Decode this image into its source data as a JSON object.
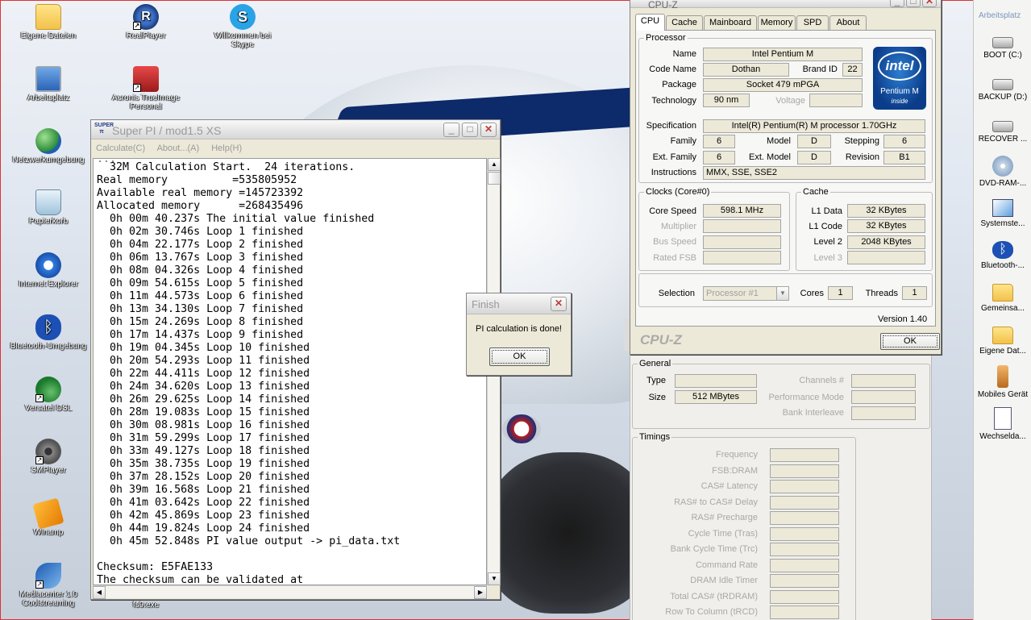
{
  "desktop": {
    "icons": [
      {
        "label": "Eigene Dateien",
        "icon": "folder-icon"
      },
      {
        "label": "Arbeitsplatz",
        "icon": "computer-icon"
      },
      {
        "label": "Netzwerkumgebung",
        "icon": "network-icon"
      },
      {
        "label": "Papierkorb",
        "icon": "recycle-bin-icon"
      },
      {
        "label": "Internet Explorer",
        "icon": "internet-explorer-icon"
      },
      {
        "label": "Bluetooth-Umgebung",
        "icon": "bluetooth-icon"
      },
      {
        "label": "Versatel DSL",
        "icon": "dsl-icon"
      },
      {
        "label": "SMPlayer",
        "icon": "smplayer-icon"
      },
      {
        "label": "Winamp",
        "icon": "winamp-icon"
      },
      {
        "label": "Mediacenter 1.0 Coolstreaming",
        "icon": "mediacenter-icon"
      },
      {
        "label": "RealPlayer",
        "icon": "realplayer-icon"
      },
      {
        "label": "Acronis TrueImage Personal",
        "icon": "acronis-icon"
      },
      {
        "label": "fs9.exe",
        "icon": "exe-icon"
      },
      {
        "label": "Willkommen bei Skype",
        "icon": "skype-icon"
      }
    ]
  },
  "rightbar": {
    "title": "Arbeitsplatz",
    "items": [
      {
        "label": "BOOT (C:)",
        "icon": "hard-drive-icon"
      },
      {
        "label": "BACKUP (D:)",
        "icon": "hard-drive-icon"
      },
      {
        "label": "RECOVER ...",
        "icon": "hard-drive-icon"
      },
      {
        "label": "DVD-RAM-...",
        "icon": "dvd-drive-icon"
      },
      {
        "label": "Systemste...",
        "icon": "control-panel-icon"
      },
      {
        "label": "Bluetooth-...",
        "icon": "bluetooth-icon"
      },
      {
        "label": "Gemeinsa...",
        "icon": "folder-icon"
      },
      {
        "label": "Eigene Dat...",
        "icon": "folder-icon"
      },
      {
        "label": "Mobiles Gerät",
        "icon": "mobile-device-icon"
      },
      {
        "label": "Wechselda...",
        "icon": "removable-drive-icon"
      }
    ]
  },
  "superpi": {
    "title": "Super PI / mod1.5 XS",
    "icon_text": "SUPER π",
    "menu": [
      "Calculate(C)",
      "About...(A)",
      "Help(H)"
    ],
    "cut_line": "...",
    "lines": [
      "  32M Calculation Start.  24 iterations.",
      "Real memory          =535805952",
      "Available real memory =145723392",
      "Allocated memory      =268435496",
      "  0h 00m 40.237s The initial value finished",
      "  0h 02m 30.746s Loop 1 finished",
      "  0h 04m 22.177s Loop 2 finished",
      "  0h 06m 13.767s Loop 3 finished",
      "  0h 08m 04.326s Loop 4 finished",
      "  0h 09m 54.615s Loop 5 finished",
      "  0h 11m 44.573s Loop 6 finished",
      "  0h 13m 34.130s Loop 7 finished",
      "  0h 15m 24.269s Loop 8 finished",
      "  0h 17m 14.437s Loop 9 finished",
      "  0h 19m 04.345s Loop 10 finished",
      "  0h 20m 54.293s Loop 11 finished",
      "  0h 22m 44.411s Loop 12 finished",
      "  0h 24m 34.620s Loop 13 finished",
      "  0h 26m 29.625s Loop 14 finished",
      "  0h 28m 19.083s Loop 15 finished",
      "  0h 30m 08.981s Loop 16 finished",
      "  0h 31m 59.299s Loop 17 finished",
      "  0h 33m 49.127s Loop 18 finished",
      "  0h 35m 38.735s Loop 19 finished",
      "  0h 37m 28.152s Loop 20 finished",
      "  0h 39m 16.568s Loop 21 finished",
      "  0h 41m 03.642s Loop 22 finished",
      "  0h 42m 45.869s Loop 23 finished",
      "  0h 44m 19.824s Loop 24 finished",
      "  0h 45m 52.848s PI value output -> pi_data.txt",
      "",
      "Checksum: E5FAE133",
      "The checksum can be validated at"
    ]
  },
  "finish": {
    "title": "Finish",
    "message": "PI calculation is done!",
    "ok_label": "OK"
  },
  "cpuz": {
    "title": "CPU-Z",
    "tabs": [
      "CPU",
      "Cache",
      "Mainboard",
      "Memory",
      "SPD",
      "About"
    ],
    "processor": {
      "legend": "Processor",
      "name_label": "Name",
      "name": "Intel Pentium M",
      "codename_label": "Code Name",
      "codename": "Dothan",
      "brandid_label": "Brand ID",
      "brandid": "22",
      "package_label": "Package",
      "package": "Socket 479 mPGA",
      "technology_label": "Technology",
      "technology": "90 nm",
      "voltage_label": "Voltage",
      "voltage": "",
      "spec_label": "Specification",
      "spec": "Intel(R) Pentium(R) M processor 1.70GHz",
      "family_label": "Family",
      "family": "6",
      "model_label": "Model",
      "model": "D",
      "stepping_label": "Stepping",
      "stepping": "6",
      "extfamily_label": "Ext. Family",
      "extfamily": "6",
      "extmodel_label": "Ext. Model",
      "extmodel": "D",
      "revision_label": "Revision",
      "revision": "B1",
      "instructions_label": "Instructions",
      "instructions": "MMX, SSE, SSE2"
    },
    "logo": {
      "brand": "intel",
      "product": "Pentium M",
      "inside": "inside"
    },
    "clocks": {
      "legend": "Clocks (Core#0)",
      "corespeed_label": "Core Speed",
      "corespeed": "598.1 MHz",
      "multiplier_label": "Multiplier",
      "multiplier": "",
      "busspeed_label": "Bus Speed",
      "busspeed": "",
      "ratedfsb_label": "Rated FSB",
      "ratedfsb": ""
    },
    "cache": {
      "legend": "Cache",
      "l1data_label": "L1 Data",
      "l1data": "32 KBytes",
      "l1code_label": "L1 Code",
      "l1code": "32 KBytes",
      "level2_label": "Level 2",
      "level2": "2048 KBytes",
      "level3_label": "Level 3",
      "level3": ""
    },
    "selection_label": "Selection",
    "selection": "Processor #1",
    "cores_label": "Cores",
    "cores": "1",
    "threads_label": "Threads",
    "threads": "1",
    "version": "Version 1.40",
    "brand_text": "CPU-Z",
    "ok_label": "OK"
  },
  "memory": {
    "general_legend": "General",
    "type_label": "Type",
    "type": "",
    "size_label": "Size",
    "size": "512 MBytes",
    "channels_label": "Channels #",
    "perfmode_label": "Performance Mode",
    "bankinterleave_label": "Bank Interleave",
    "timings_legend": "Timings",
    "timings": [
      "Frequency",
      "FSB:DRAM",
      "CAS# Latency",
      "RAS# to CAS# Delay",
      "RAS# Precharge",
      "Cycle Time (Tras)",
      "Bank Cycle Time (Trc)",
      "Command Rate",
      "DRAM Idle Timer",
      "Total CAS# (tRDRAM)",
      "Row To Column (tRCD)"
    ]
  },
  "colors": {
    "wallpaper_stripe": "#0d2a6a",
    "window_face": "#ece9d8",
    "close_red": "#c03a3a"
  }
}
